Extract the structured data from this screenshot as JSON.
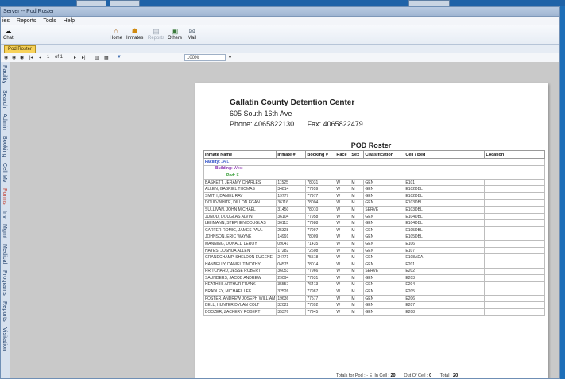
{
  "window": {
    "title": "Server -- Pod Roster"
  },
  "menu": [
    "ies",
    "Reports",
    "Tools",
    "Help"
  ],
  "ribbon": {
    "chat": "Chat",
    "home": "Home",
    "inmates": "Inmates",
    "reports": "Reports",
    "others": "Others",
    "mail": "Mail"
  },
  "tab": "Pod Roster",
  "viewer": {
    "page": "1",
    "of": "of 1",
    "zoom": "100%"
  },
  "sidebar": [
    "Facility",
    "Search",
    "Admin",
    "Booking",
    "Cell Mv",
    "Forms",
    "Inv",
    "Mgmt",
    "Medical",
    "Programs",
    "Reports",
    "Visitation"
  ],
  "report": {
    "agency": "Gallatin County Detention Center",
    "address": "605 South 16th Ave",
    "phone_label": "Phone:",
    "phone": "4065822130",
    "fax_label": "Fax:",
    "fax": "4065822479",
    "title": "POD Roster",
    "columns": [
      "Inmate Name",
      "Inmate #",
      "Booking #",
      "Race",
      "Sex",
      "Classification",
      "Cell / Bed",
      "Location"
    ],
    "facility_label": "Facility:",
    "facility": "JAIL",
    "building_label": "Building:",
    "building": "West",
    "pod_label": "Pod:",
    "pod": "E",
    "rows": [
      [
        "BASKETT, JERAMY CHARLES",
        "11525",
        "78031",
        "W",
        "M",
        "GEN",
        "E101",
        ""
      ],
      [
        "ALLEN, GABRIEL THOMAS",
        "34814",
        "77959",
        "W",
        "M",
        "GEN",
        "E102DBL",
        ""
      ],
      [
        "SMITH, DANIEL RAY",
        "19777",
        "77977",
        "W",
        "M",
        "GEN",
        "E102DBL",
        ""
      ],
      [
        "DOUD-WHITE, DILLON EGAN",
        "36116",
        "78004",
        "W",
        "M",
        "GEN",
        "E103DBL",
        ""
      ],
      [
        "SULLIVAN, JOHN MICHAEL",
        "31450",
        "78010",
        "W",
        "M",
        "SERVE",
        "E103DBL",
        ""
      ],
      [
        "JUNOD, DOUGLAS ALVIN",
        "36104",
        "77958",
        "W",
        "M",
        "GEN",
        "E104DBL",
        ""
      ],
      [
        "LEHMANN, STEPHEN DOUGLAS",
        "36113",
        "77988",
        "W",
        "M",
        "GEN",
        "E104DBL",
        ""
      ],
      [
        "CARTER-ROMIG, JAMES PAUL",
        "25328",
        "77997",
        "W",
        "M",
        "GEN",
        "E105DBL",
        ""
      ],
      [
        "JOHNSON, ERIC WAYNE",
        "14991",
        "78009",
        "W",
        "M",
        "GEN",
        "E105DBL",
        ""
      ],
      [
        "MANNING, DONALD LEROY",
        "09041",
        "71435",
        "W",
        "M",
        "GEN",
        "E106",
        ""
      ],
      [
        "HAYES, JOSHUA ALLEN",
        "17282",
        "72608",
        "W",
        "M",
        "GEN",
        "E107",
        ""
      ],
      [
        "GRANDCHAMP, SHELDON EUGENE",
        "24771",
        "75518",
        "W",
        "M",
        "GEN",
        "E108ADA",
        ""
      ],
      [
        "HANNELLY, DANIEL TIMOTHY",
        "04575",
        "78014",
        "W",
        "M",
        "GEN",
        "E201",
        ""
      ],
      [
        "PRITCHARD, JESSE ROBERT",
        "36053",
        "77966",
        "W",
        "M",
        "SERVE",
        "E202",
        ""
      ],
      [
        "SAUNDERS, JACOB ANDREW",
        "29094",
        "77931",
        "W",
        "M",
        "GEN",
        "E203",
        ""
      ],
      [
        "HEATH III, ARTHUR FRANK",
        "35557",
        "76413",
        "W",
        "M",
        "GEN",
        "E204",
        ""
      ],
      [
        "BRADLEY, MICHAEL LEE",
        "32526",
        "77987",
        "W",
        "M",
        "GEN",
        "E205",
        ""
      ],
      [
        "FOSTER, ANDREW JOSEPH WILLIAM",
        "19636",
        "77577",
        "W",
        "M",
        "GEN",
        "E206",
        ""
      ],
      [
        "BELL, HUNTER DYLAN COLT",
        "32022",
        "77392",
        "W",
        "M",
        "GEN",
        "E207",
        ""
      ],
      [
        "BOOZER, ZACKERY ROBERT",
        "35376",
        "77945",
        "W",
        "M",
        "GEN",
        "E208",
        ""
      ]
    ],
    "totals": {
      "label": "Totals for Pod : - E",
      "in_cell_label": "In Cell :",
      "in_cell": "20",
      "out_label": "Out Of Cell :",
      "out": "0",
      "total_label": "Total :",
      "total": "20"
    }
  }
}
